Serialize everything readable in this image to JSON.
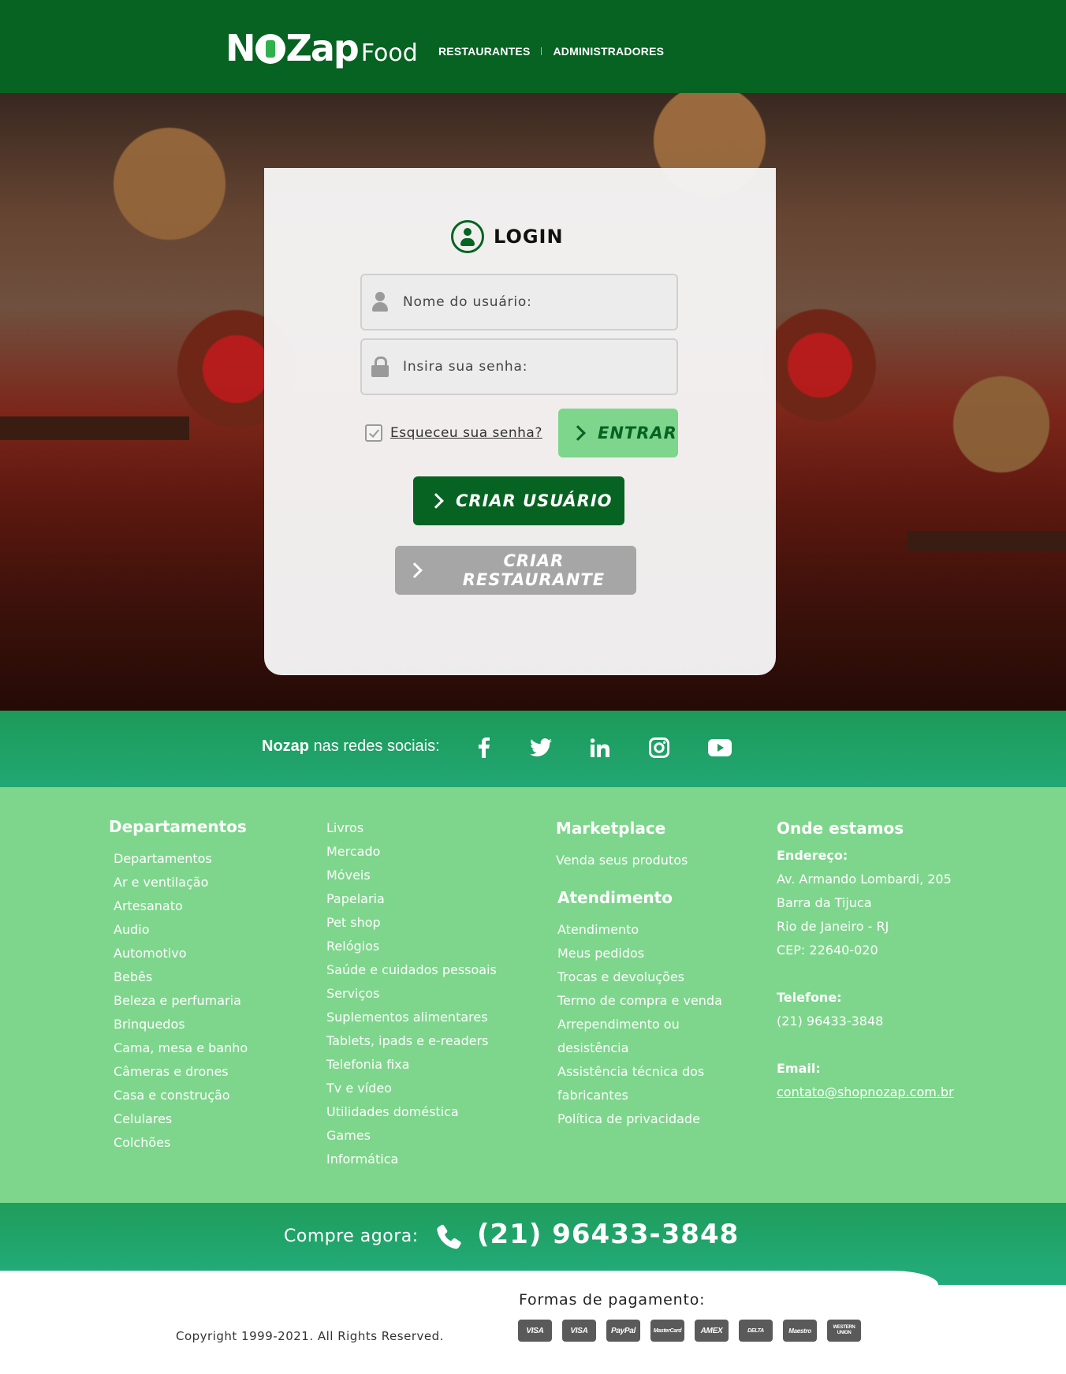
{
  "header": {
    "logo_main": "NOZap",
    "logo_sub": "Food",
    "nav": [
      "RESTAURANTES",
      "ADMINISTRADORES"
    ]
  },
  "login": {
    "title": "LOGIN",
    "username_placeholder": "Nome do usuário:",
    "password_placeholder": "Insira sua senha:",
    "forgot_label": "Esqueceu sua senha?",
    "enter_label": "ENTRAR",
    "create_user_label": "CRIAR USUÁRIO",
    "create_restaurant_label": "CRIAR RESTAURANTE"
  },
  "social": {
    "brand": "Nozap",
    "label": "nas redes sociais:",
    "icons": [
      "facebook-icon",
      "twitter-icon",
      "linkedin-icon",
      "instagram-icon",
      "youtube-icon"
    ]
  },
  "footer": {
    "departamentos": {
      "title": "Departamentos",
      "items": [
        "Departamentos",
        "Ar e ventilação",
        "Artesanato",
        "Audio",
        "Automotivo",
        "Bebês",
        "Beleza e perfumaria",
        "Brinquedos",
        "Cama, mesa e banho",
        "Câmeras e drones",
        "Casa e construção",
        "Celulares",
        "Colchões"
      ]
    },
    "departamentos2": {
      "items": [
        "Livros",
        "Mercado",
        "Móveis",
        "Papelaria",
        "Pet shop",
        "Relógios",
        "Saúde e cuidados pessoais",
        "Serviços",
        "Suplementos alimentares",
        "Tablets, ipads e e-readers",
        "Telefonia fixa",
        "Tv e vídeo",
        "Utilidades doméstica",
        "Games",
        "Informática"
      ]
    },
    "marketplace": {
      "title": "Marketplace",
      "items": [
        "Venda seus produtos"
      ]
    },
    "atendimento": {
      "title": "Atendimento",
      "items": [
        "Atendimento",
        "Meus pedidos",
        "Trocas e devoluções",
        "Termo de compra e venda",
        "Arrependimento ou",
        "desistência",
        "Assistência técnica dos",
        "fabricantes",
        "Política de privacidade"
      ]
    },
    "onde": {
      "title": "Onde estamos",
      "address_label": "Endereço:",
      "address_lines": [
        "Av. Armando Lombardi, 205",
        "Barra da Tijuca",
        "Rio de Janeiro - RJ",
        "CEP: 22640-020"
      ],
      "phone_label": "Telefone:",
      "phone": "(21) 96433-3848",
      "email_label": "Email:",
      "email": "contato@shopnozap.com.br"
    }
  },
  "callbar": {
    "label": "Compre agora:",
    "number": "(21) 96433-3848"
  },
  "bottom": {
    "copyright": "Copyright 1999-2021. All Rights Reserved.",
    "payment_label": "Formas de pagamento:",
    "cards": [
      "VISA",
      "VISA",
      "PayPal",
      "MasterCard",
      "AMEX",
      "DELTA",
      "Maestro",
      "WESTERN UNION"
    ]
  },
  "colors": {
    "header": "#066322",
    "accent_light": "#7ed58c",
    "social_strip": "#1c9a58",
    "footer": "#7ed68c"
  }
}
